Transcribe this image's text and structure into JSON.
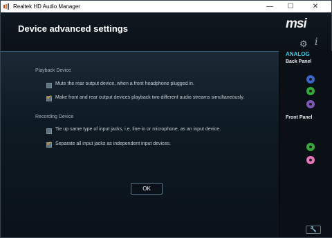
{
  "window": {
    "title": "Realtek HD Audio Manager",
    "controls": {
      "minimize": "—",
      "maximize": "☐",
      "close": "✕"
    }
  },
  "header": {
    "page_title": "Device advanced settings",
    "logo_text": "msi",
    "gear_icon": "⚙",
    "info_icon": "i"
  },
  "playback": {
    "heading": "Playback Device",
    "options": [
      {
        "label": "Mute the rear output device, when a front headphone plugged in.",
        "checked": false
      },
      {
        "label": "Make front and rear output devices playback two different audio streams simultaneously.",
        "checked": true
      }
    ]
  },
  "recording": {
    "heading": "Recording Device",
    "options": [
      {
        "label": "Tie up same type of input jacks, i.e. line-in or microphone, as an input device.",
        "checked": false
      },
      {
        "label": "Separate all input jacks as independent input devices.",
        "checked": true
      }
    ]
  },
  "ok_button": {
    "label": "OK"
  },
  "sidebar": {
    "analog_label": "ANALOG",
    "back_panel_label": "Back Panel",
    "front_panel_label": "Front Panel",
    "back_jacks": [
      {
        "name": "blue-jack",
        "color": "#3a67c9"
      },
      {
        "name": "green-jack",
        "color": "#35a93a"
      },
      {
        "name": "purple-jack",
        "color": "#7d58b5"
      }
    ],
    "front_jacks": [
      {
        "name": "green-jack",
        "color": "#35a93a"
      },
      {
        "name": "pink-jack",
        "color": "#e774b9"
      }
    ],
    "wrench_icon": "🔧"
  },
  "colors": {
    "accent": "#3ec6e0",
    "checkmark": "#d89a2a"
  }
}
